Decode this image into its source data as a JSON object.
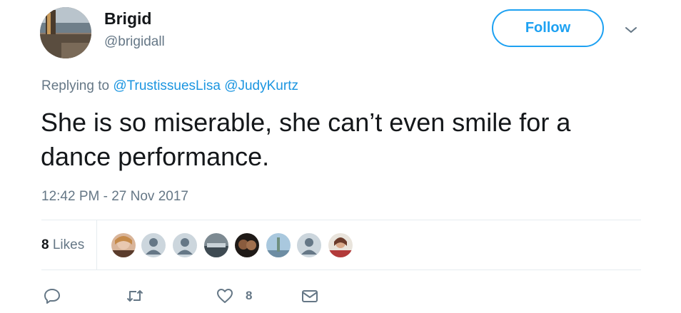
{
  "author": {
    "name": "Brigid",
    "handle": "@brigidall"
  },
  "follow_label": "Follow",
  "replying": {
    "prefix": "Replying to",
    "mentions": [
      "@TrustissuesLisa",
      "@JudyKurtz"
    ]
  },
  "tweet_text": "She is so miserable, she can’t even smile for a dance performance.",
  "timestamp": "12:42 PM - 27 Nov 2017",
  "likes": {
    "count": "8",
    "label": "Likes"
  },
  "actions": {
    "reply_icon": "reply-icon",
    "retweet_icon": "retweet-icon",
    "like_icon": "heart-icon",
    "like_count": "8",
    "dm_icon": "envelope-icon"
  },
  "colors": {
    "accent": "#1da1f2",
    "link": "#1b95e0",
    "muted": "#657786",
    "text": "#14171a"
  }
}
